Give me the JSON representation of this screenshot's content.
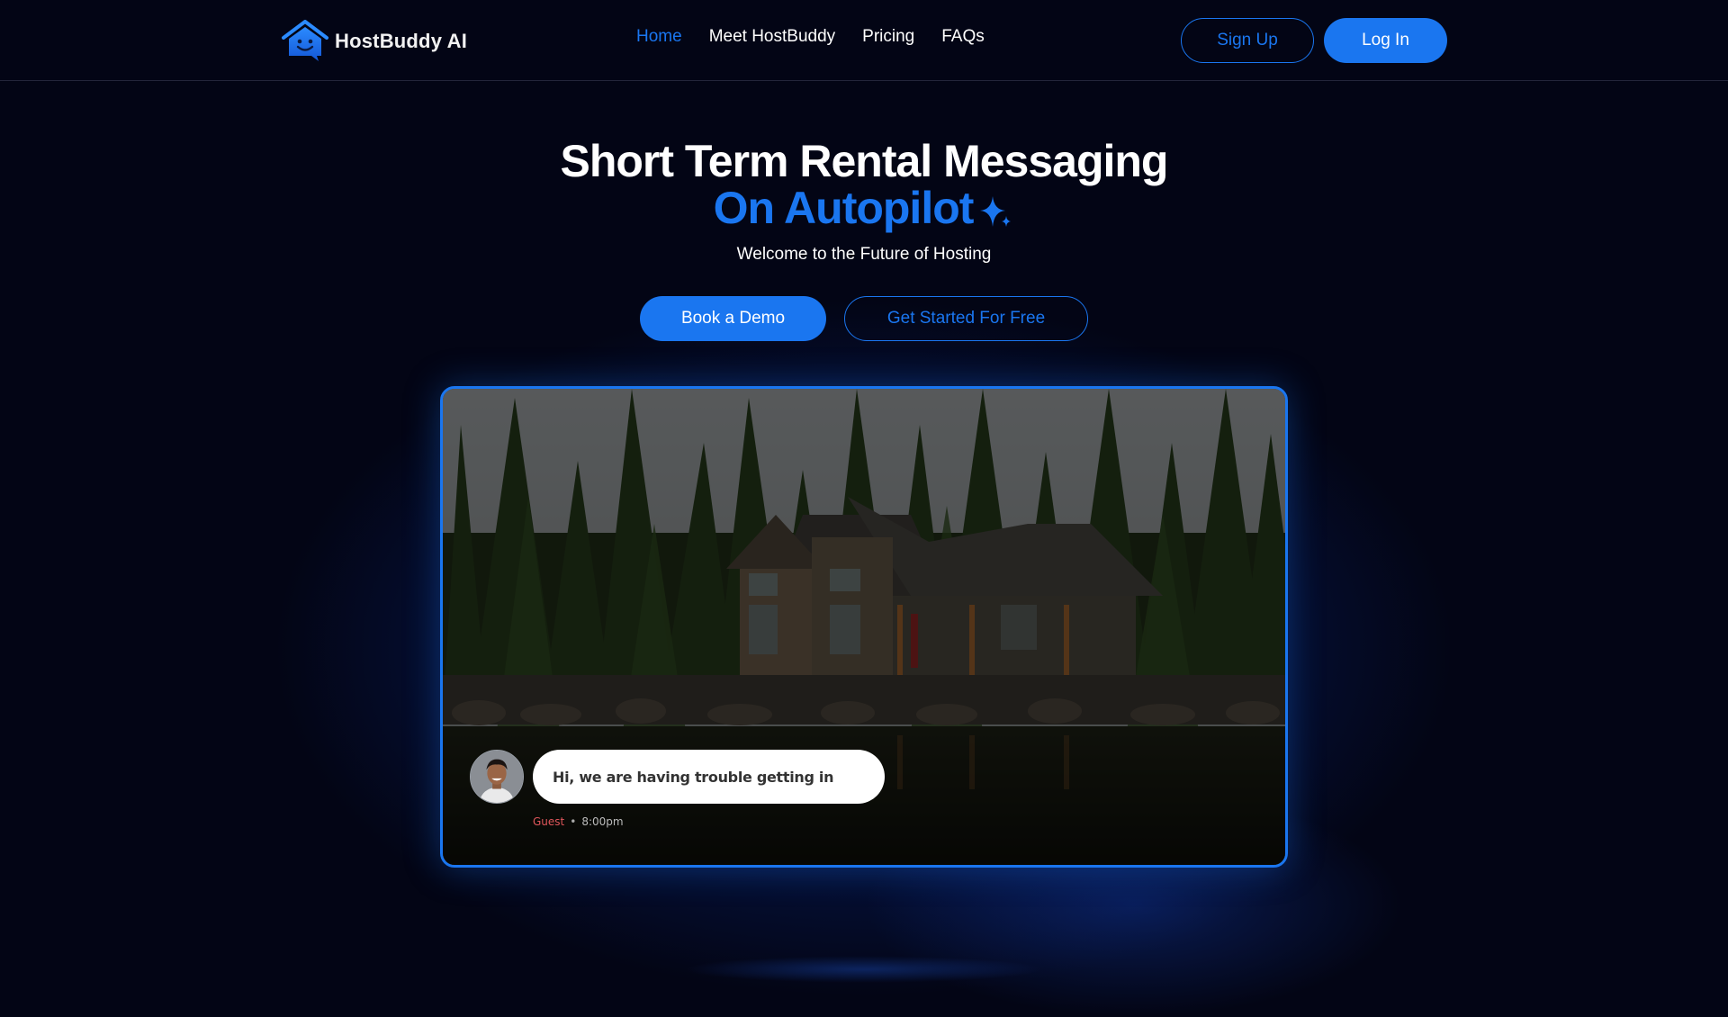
{
  "brand": {
    "name": "HostBuddy AI",
    "accent": "#1a76f0",
    "background": "#030515"
  },
  "nav": {
    "links": [
      {
        "label": "Home",
        "active": true
      },
      {
        "label": "Meet HostBuddy",
        "active": false
      },
      {
        "label": "Pricing",
        "active": false
      },
      {
        "label": "FAQs",
        "active": false
      }
    ],
    "signup_label": "Sign Up",
    "login_label": "Log In"
  },
  "hero": {
    "title_line1": "Short Term Rental Messaging",
    "title_line2": "On Autopilot",
    "sparkle_icon": "sparkle-icon",
    "subtitle": "Welcome to the Future of Hosting",
    "primary_cta": "Book a Demo",
    "secondary_cta": "Get Started For Free"
  },
  "showcase": {
    "image_description": "Cabin by a lake surrounded by pine trees",
    "chat": {
      "message": "Hi, we are having trouble getting in",
      "sender": "Guest",
      "separator": "•",
      "time": "8:00pm",
      "sender_color": "#e0565b"
    }
  }
}
